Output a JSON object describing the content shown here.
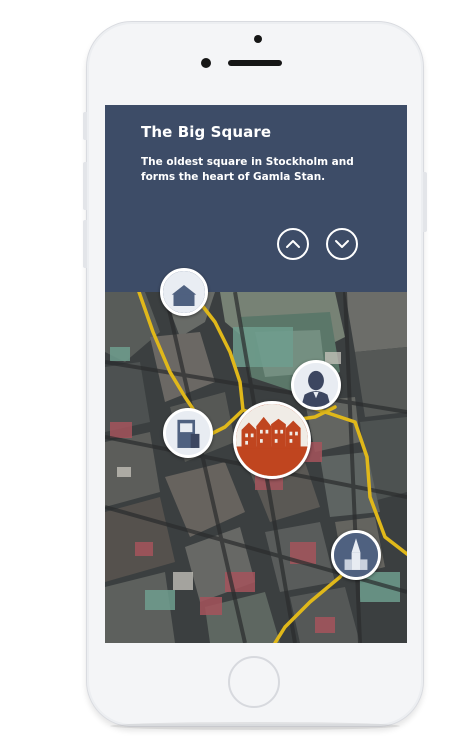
{
  "poi": {
    "title": "The Big Square",
    "description": "The oldest square in Stockholm and forms the heart of Gamla Stan."
  },
  "controls": {
    "up_icon": "chevron-up-icon",
    "down_icon": "chevron-down-icon"
  },
  "map": {
    "route_color": "#e0b81a",
    "markers": [
      {
        "name": "poi-marker-top",
        "icon": "building-illustration"
      },
      {
        "name": "poi-marker-portrait",
        "icon": "portrait-illustration"
      },
      {
        "name": "poi-marker-monument",
        "icon": "monument-illustration"
      },
      {
        "name": "poi-marker-big-square",
        "icon": "facades-illustration",
        "selected": true
      },
      {
        "name": "poi-marker-church",
        "icon": "church-illustration"
      }
    ]
  },
  "colors": {
    "panel": "#3d4c67",
    "selected_marker": "#c0451f",
    "marker": "#4f6180"
  }
}
